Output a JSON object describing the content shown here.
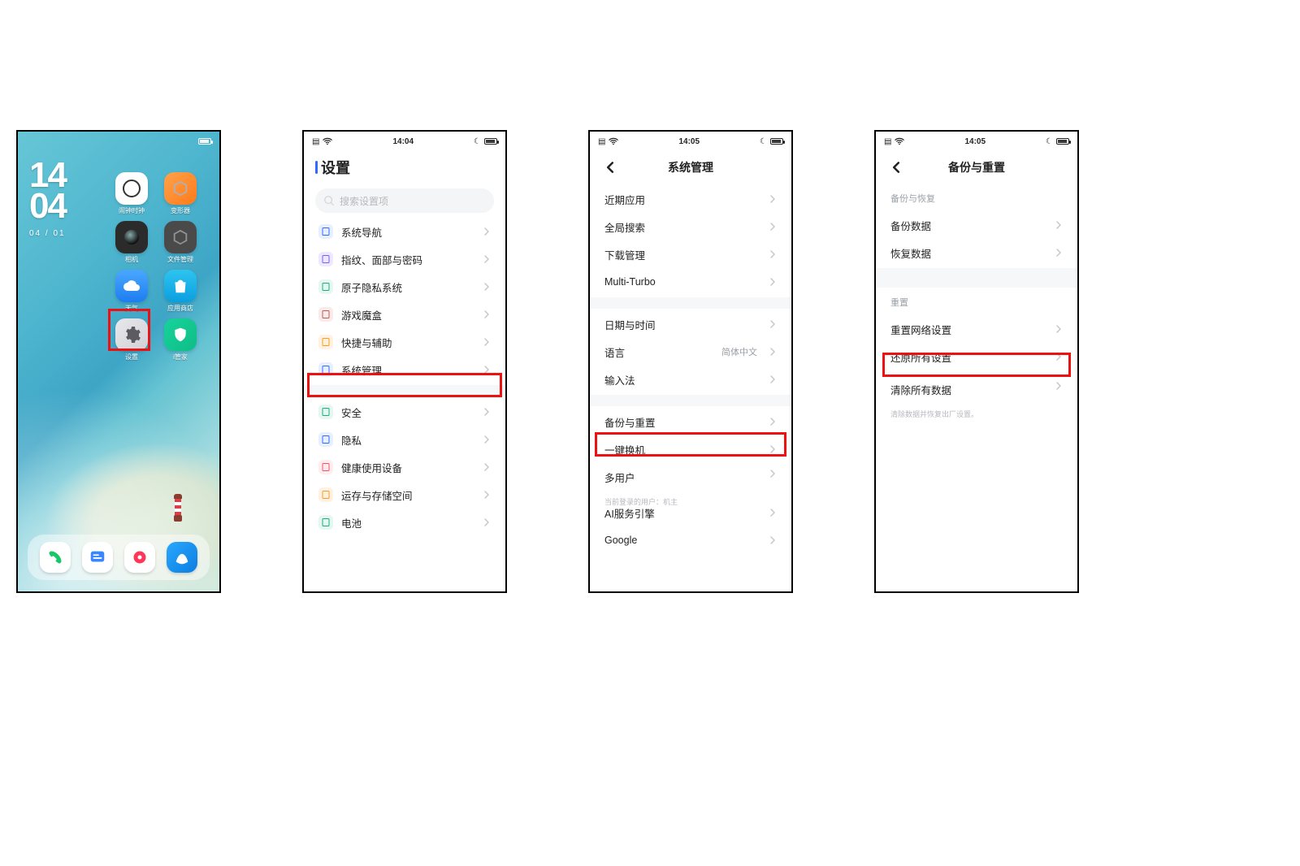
{
  "phones": {
    "home": {
      "status": {
        "time": "14:04",
        "battery": "94"
      },
      "clock": {
        "hours": "14",
        "minutes": "04",
        "date": "04 / 01"
      },
      "apps": [
        {
          "name": "clock",
          "label": "闹钟时钟"
        },
        {
          "name": "themes",
          "label": "变形器"
        },
        {
          "name": "camera",
          "label": "相机"
        },
        {
          "name": "cube",
          "label": "文件管理"
        },
        {
          "name": "weather",
          "label": "天气"
        },
        {
          "name": "store",
          "label": "应用商店"
        },
        {
          "name": "gear",
          "label": "设置"
        },
        {
          "name": "imgr",
          "label": "i管家"
        }
      ]
    },
    "settings": {
      "status": {
        "time": "14:04",
        "battery": "94"
      },
      "title": "设置",
      "search_placeholder": "搜索设置项",
      "group1": [
        {
          "id": "nav",
          "label": "系统导航"
        },
        {
          "id": "finger",
          "label": "指纹、面部与密码"
        },
        {
          "id": "priv",
          "label": "原子隐私系统"
        },
        {
          "id": "game",
          "label": "游戏魔盒"
        },
        {
          "id": "short",
          "label": "快捷与辅助"
        },
        {
          "id": "sys",
          "label": "系统管理",
          "highlight": true
        }
      ],
      "group2": [
        {
          "id": "sec",
          "label": "安全"
        },
        {
          "id": "lockp",
          "label": "隐私"
        },
        {
          "id": "health",
          "label": "健康使用设备"
        },
        {
          "id": "storage",
          "label": "运存与存储空间"
        },
        {
          "id": "batt",
          "label": "电池"
        }
      ]
    },
    "sysmgmt": {
      "status": {
        "time": "14:05",
        "battery": "94"
      },
      "title": "系统管理",
      "group1": [
        {
          "label": "近期应用"
        },
        {
          "label": "全局搜索"
        },
        {
          "label": "下载管理"
        },
        {
          "label": "Multi-Turbo"
        }
      ],
      "group2": [
        {
          "label": "日期与时间"
        },
        {
          "label": "语言",
          "value": "简体中文"
        },
        {
          "label": "输入法"
        }
      ],
      "group3": [
        {
          "label": "备份与重置",
          "highlight": true
        },
        {
          "label": "一键换机"
        },
        {
          "label": "多用户",
          "sub": "当前登录的用户：机主"
        },
        {
          "label": "AI服务引擎"
        },
        {
          "label": "Google"
        }
      ]
    },
    "backup": {
      "status": {
        "time": "14:05",
        "battery": "94"
      },
      "title": "备份与重置",
      "section1_label": "备份与恢复",
      "section1": [
        {
          "label": "备份数据"
        },
        {
          "label": "恢复数据"
        }
      ],
      "section2_label": "重置",
      "section2": [
        {
          "label": "重置网络设置"
        },
        {
          "label": "还原所有设置",
          "highlight": true
        },
        {
          "label": "清除所有数据",
          "sub": "清除数据并恢复出厂设置。"
        }
      ]
    }
  }
}
